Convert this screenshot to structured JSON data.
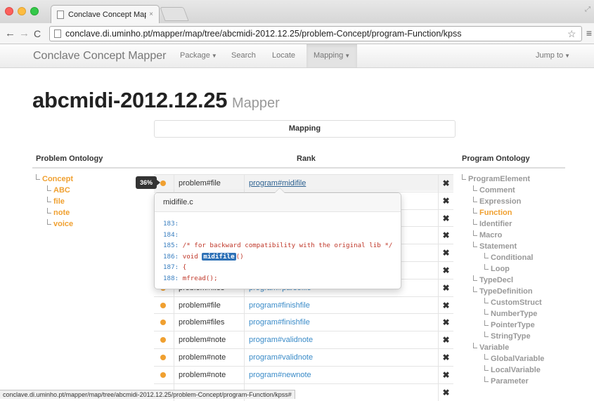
{
  "browser": {
    "tab_title": "Conclave Concept Mapper",
    "tab_close": "×",
    "url": "conclave.di.uminho.pt/mapper/map/tree/abcmidi-2012.12.25/problem-Concept/program-Function/kpss",
    "status_url": "conclave.di.uminho.pt/mapper/map/tree/abcmidi-2012.12.25/problem-Concept/program-Function/kpss#"
  },
  "navbar": {
    "brand": "Conclave Concept Mapper",
    "items": [
      {
        "label": "Package",
        "caret": true
      },
      {
        "label": "Search"
      },
      {
        "label": "Locate"
      },
      {
        "label": "Mapping",
        "caret": true,
        "active": true
      }
    ],
    "jump": "Jump to"
  },
  "header": {
    "title": "abcmidi-2012.12.25",
    "subtitle": "Mapper",
    "mapping_label": "Mapping"
  },
  "columns": {
    "problem": "Problem Ontology",
    "rank": "Rank",
    "program": "Program Ontology"
  },
  "problem_tree": {
    "root": "Concept",
    "children": [
      "ABC",
      "file",
      "note",
      "voice"
    ]
  },
  "program_tree": {
    "root": "ProgramElement",
    "level1": [
      "Comment",
      "Expression",
      "Function",
      "Identifier",
      "Macro",
      "Statement",
      "TypeDecl",
      "TypeDefinition",
      "Variable"
    ],
    "statement_children": [
      "Conditional",
      "Loop"
    ],
    "typedef_children": [
      "CustomStruct",
      "NumberType",
      "PointerType",
      "StringType"
    ],
    "variable_children": [
      "GlobalVariable",
      "LocalVariable",
      "Parameter"
    ],
    "highlight": "Function"
  },
  "rank": {
    "badge": "36%",
    "remove_glyph": "✖",
    "rows": [
      {
        "problem": "problem#file",
        "program": "program#midifile"
      },
      {
        "problem": "",
        "program": ""
      },
      {
        "problem": "",
        "program": ""
      },
      {
        "problem": "",
        "program": ""
      },
      {
        "problem": "",
        "program": ""
      },
      {
        "problem": "",
        "program": ""
      },
      {
        "problem": "problem#files",
        "program": "program#parsefile"
      },
      {
        "problem": "problem#file",
        "program": "program#finishfile"
      },
      {
        "problem": "problem#files",
        "program": "program#finishfile"
      },
      {
        "problem": "problem#note",
        "program": "program#validnote"
      },
      {
        "problem": "problem#note",
        "program": "program#validnote"
      },
      {
        "problem": "problem#note",
        "program": "program#newnote"
      },
      {
        "problem": "",
        "program": ""
      }
    ]
  },
  "popover": {
    "title": "midifile.c",
    "lines": [
      {
        "num": "183:",
        "code": ""
      },
      {
        "num": "184:",
        "code": ""
      },
      {
        "num": "185:",
        "code": "/* for backward compatibility with the original lib */"
      },
      {
        "num": "186:",
        "pre": "void ",
        "highlight": "midifile",
        "post": "()"
      },
      {
        "num": "187:",
        "code": "{"
      },
      {
        "num": "188:",
        "code": "mfread();"
      }
    ]
  },
  "colors": {
    "accent_orange": "#f0a030",
    "link_blue": "#3a8bc8",
    "highlight_blue": "#2f72b7"
  }
}
